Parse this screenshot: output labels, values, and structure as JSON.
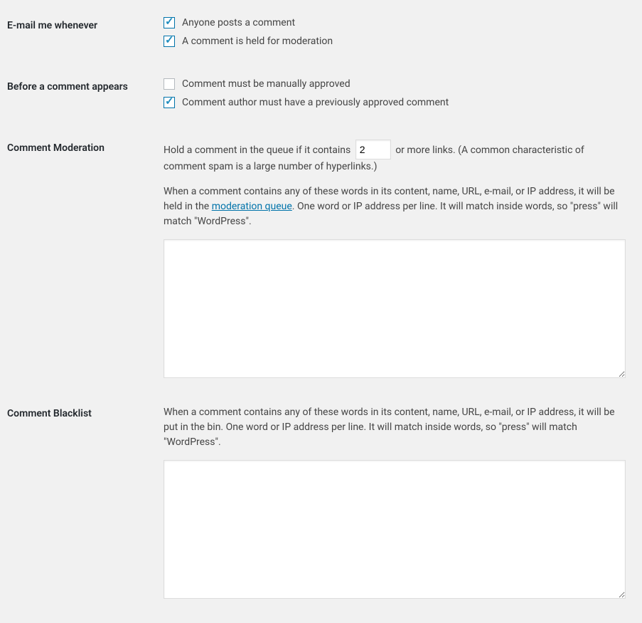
{
  "emailMe": {
    "heading": "E-mail me whenever",
    "opt1": "Anyone posts a comment",
    "opt2": "A comment is held for moderation"
  },
  "beforeAppears": {
    "heading": "Before a comment appears",
    "opt1": "Comment must be manually approved",
    "opt2": "Comment author must have a previously approved comment"
  },
  "moderation": {
    "heading": "Comment Moderation",
    "holdPrefix": "Hold a comment in the queue if it contains",
    "linksValue": "2",
    "holdSuffix": "or more links. (A common characteristic of comment spam is a large number of hyperlinks.)",
    "desc1a": "When a comment contains any of these words in its content, name, URL, e-mail, or IP address, it will be held in the ",
    "desc1link": "moderation queue",
    "desc1b": ". One word or IP address per line. It will match inside words, so \"press\" will match \"WordPress\"."
  },
  "blacklist": {
    "heading": "Comment Blacklist",
    "desc": "When a comment contains any of these words in its content, name, URL, e-mail, or IP address, it will be put in the bin. One word or IP address per line. It will match inside words, so \"press\" will match \"WordPress\"."
  }
}
